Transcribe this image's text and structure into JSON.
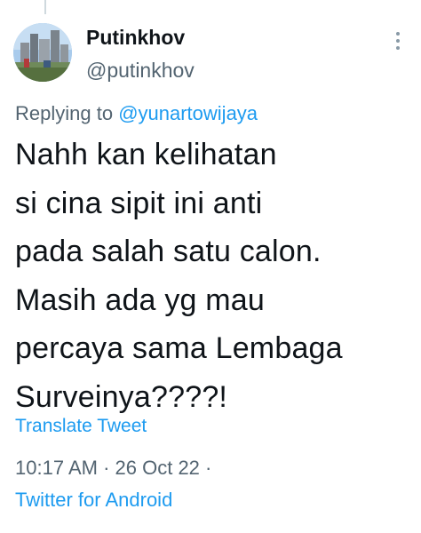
{
  "tweet": {
    "author": {
      "display_name": "Putinkhov",
      "handle": "@putinkhov"
    },
    "replying_label": "Replying to ",
    "replying_to": "@yunartowijaya",
    "text": "Nahh kan kelihatan\nsi cina sipit ini anti\npada salah satu calon.\nMasih ada yg mau\npercaya sama Lembaga\nSurveinya????!",
    "translate_label": "Translate Tweet",
    "time": "10:17 AM",
    "date": "26 Oct 22",
    "separator": "·",
    "source": "Twitter for Android"
  },
  "icons": {
    "more": "more-vertical-icon"
  },
  "colors": {
    "link": "#1d9bf0",
    "secondary_text": "#536471",
    "primary_text": "#0f1419"
  }
}
